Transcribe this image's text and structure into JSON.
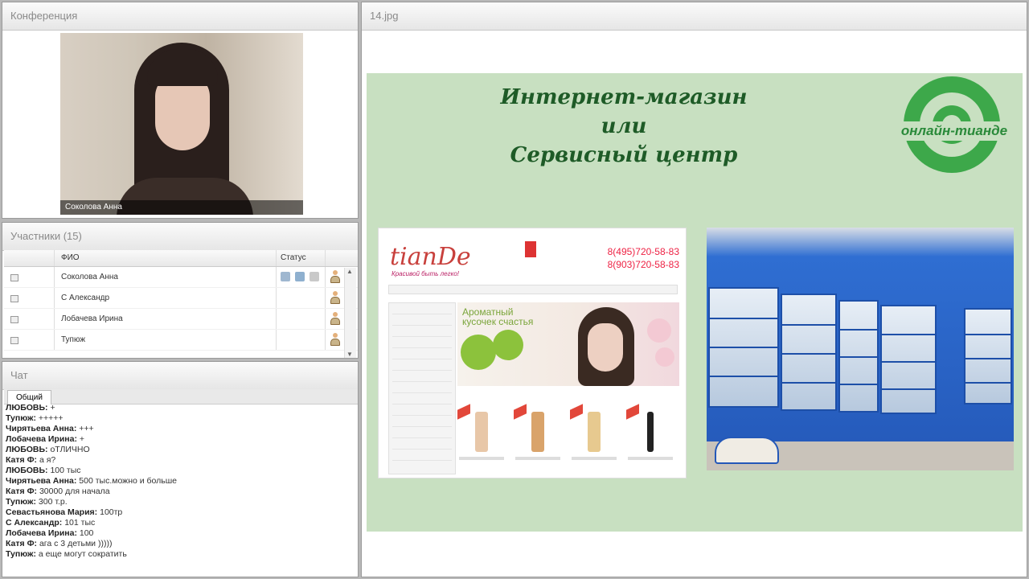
{
  "conference": {
    "title": "Конференция",
    "video_label": "Соколова Анна"
  },
  "participants": {
    "title": "Участники (15)",
    "columns": {
      "name": "ФИО",
      "status": "Статус"
    },
    "rows": [
      {
        "name": "Соколова Анна"
      },
      {
        "name": "С Александр"
      },
      {
        "name": "Лобачева Ирина"
      },
      {
        "name": "Тупюж"
      }
    ]
  },
  "chat": {
    "title": "Чат",
    "tab": "Общий",
    "messages": [
      {
        "author": "ЛЮБОВЬ:",
        "text": " +"
      },
      {
        "author": "Тупюж:",
        "text": " +++++"
      },
      {
        "author": "Чирятьева Анна:",
        "text": " +++"
      },
      {
        "author": "Лобачева Ирина:",
        "text": " +"
      },
      {
        "author": "ЛЮБОВЬ:",
        "text": " оТЛИЧНО"
      },
      {
        "author": "Катя Ф:",
        "text": " а я?"
      },
      {
        "author": "ЛЮБОВЬ:",
        "text": " 100 тыс"
      },
      {
        "author": "Чирятьева Анна:",
        "text": " 500 тыс.можно и больше"
      },
      {
        "author": "Катя Ф:",
        "text": " 30000 для начала"
      },
      {
        "author": "Тупюж:",
        "text": " 300 т.р."
      },
      {
        "author": "Севастьянова Мария:",
        "text": " 100тр"
      },
      {
        "author": "С Александр:",
        "text": " 101 тыс"
      },
      {
        "author": "Лобачева Ирина:",
        "text": " 100"
      },
      {
        "author": "Катя Ф:",
        "text": " ага с 3 детьми )))))"
      },
      {
        "author": "Тупюж:",
        "text": " а еще могут сократить"
      }
    ]
  },
  "slide": {
    "title": "14.jpg",
    "heading_line1": "Интернет-магазин",
    "heading_line2": "или",
    "heading_line3": "Сервисный центр",
    "logo_text": "онлайн-тианде",
    "site": {
      "brand": "tianDe",
      "tagline": "Красивой быть легко!",
      "phone1": "8(495)720-58-83",
      "phone2": "8(903)720-58-83",
      "banner_text_line1": "Ароматный",
      "banner_text_line2": "кусочек счастья"
    }
  },
  "colors": {
    "slide_bg": "#c8e0c1",
    "heading": "#1e5b27",
    "logo_green": "#3da84a",
    "brand_red": "#c8403c"
  }
}
